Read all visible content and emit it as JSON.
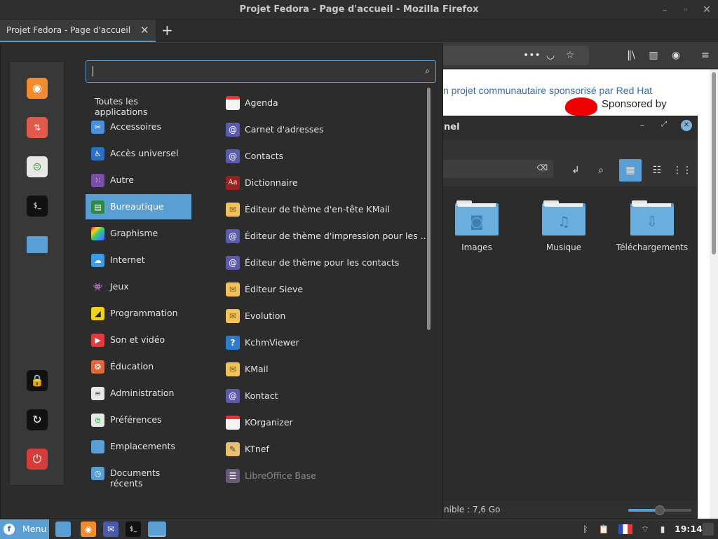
{
  "window": {
    "title": "Projet Fedora - Page d'accueil - Mozilla Firefox"
  },
  "tab": {
    "label": "Projet Fedora - Page d'accueil",
    "close": "✕",
    "new": "+"
  },
  "webpage": {
    "fedora_link": "n projet communautaire sponsorisé par Red Hat",
    "sponsored": "Sponsored by",
    "redhat": "Red Hat"
  },
  "filemanager": {
    "title": "nel",
    "folders": [
      "Images",
      "Musique",
      "Téléchargements"
    ],
    "status": "nible : 7,6 Go",
    "zoom_level": 0.5
  },
  "menu": {
    "search": {
      "value": "",
      "placeholder": ""
    },
    "categories": [
      {
        "label": "Toutes les applications",
        "icon": "none"
      },
      {
        "label": "Accessoires",
        "icon": "scissors-icon"
      },
      {
        "label": "Accès universel",
        "icon": "accessibility-icon"
      },
      {
        "label": "Autre",
        "icon": "grid-icon"
      },
      {
        "label": "Bureautique",
        "icon": "office-icon"
      },
      {
        "label": "Graphisme",
        "icon": "palette-icon"
      },
      {
        "label": "Internet",
        "icon": "cloud-icon"
      },
      {
        "label": "Jeux",
        "icon": "invader-icon"
      },
      {
        "label": "Programmation",
        "icon": "programming-icon"
      },
      {
        "label": "Son et vidéo",
        "icon": "play-icon"
      },
      {
        "label": "Éducation",
        "icon": "education-icon"
      },
      {
        "label": "Administration",
        "icon": "admin-icon"
      },
      {
        "label": "Préférences",
        "icon": "preferences-icon"
      },
      {
        "label": "Emplacements",
        "icon": "folder-icon"
      },
      {
        "label": "Documents récents",
        "icon": "recent-docs-icon"
      }
    ],
    "selected_category": "Bureautique",
    "apps": [
      {
        "label": "Agenda",
        "icon": "calendar-icon"
      },
      {
        "label": "Carnet d'adresses",
        "icon": "at-icon"
      },
      {
        "label": "Contacts",
        "icon": "at-icon"
      },
      {
        "label": "Dictionnaire",
        "icon": "dictionary-icon"
      },
      {
        "label": "Éditeur de thème d'en-tête KMail",
        "icon": "mail-icon"
      },
      {
        "label": "Éditeur de thème d'impression pour les ...",
        "icon": "at-icon"
      },
      {
        "label": "Éditeur de thème pour les contacts",
        "icon": "at-icon"
      },
      {
        "label": "Éditeur Sieve",
        "icon": "mail-icon"
      },
      {
        "label": "Evolution",
        "icon": "mail-icon"
      },
      {
        "label": "KchmViewer",
        "icon": "help-icon"
      },
      {
        "label": "KMail",
        "icon": "mail-icon"
      },
      {
        "label": "Kontact",
        "icon": "at-icon"
      },
      {
        "label": "KOrganizer",
        "icon": "calendar-icon"
      },
      {
        "label": "KTnef",
        "icon": "ktnef-icon"
      },
      {
        "label": "LibreOffice Base",
        "icon": "database-icon"
      }
    ],
    "favorites": [
      "firefox-icon",
      "software-update-icon",
      "settings-toggle-icon",
      "terminal-icon",
      "files-icon"
    ],
    "session": [
      "lock-icon",
      "logout-icon",
      "power-icon"
    ]
  },
  "panel": {
    "menu_label": "Menu",
    "clock": "19:14",
    "launchers": [
      "files-icon",
      "firefox-icon",
      "mail-icon",
      "terminal-icon",
      "files-icon"
    ]
  },
  "colors": {
    "accent": "#5a9fd4",
    "bg": "#2c2c2c"
  }
}
